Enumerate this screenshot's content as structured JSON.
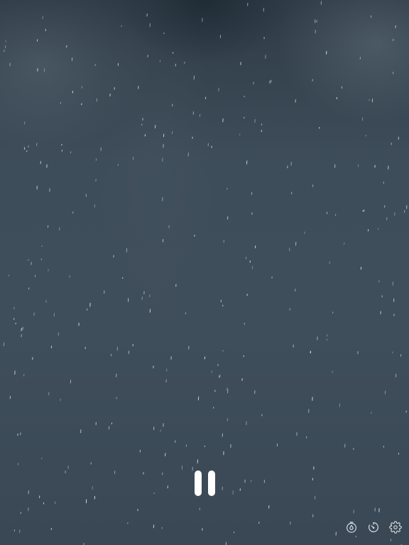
{
  "scene": {
    "effect": "rain",
    "playing": true
  },
  "controls": {
    "pause_icon": "pause-icon",
    "toolbar_icons": [
      "raindrop-timer-icon",
      "timer-icon",
      "gear-icon"
    ]
  },
  "colors": {
    "background": "#3d4c59",
    "foreground": "#ffffff",
    "icon": "#d8dde2",
    "raindrop": "#e8eef2"
  }
}
